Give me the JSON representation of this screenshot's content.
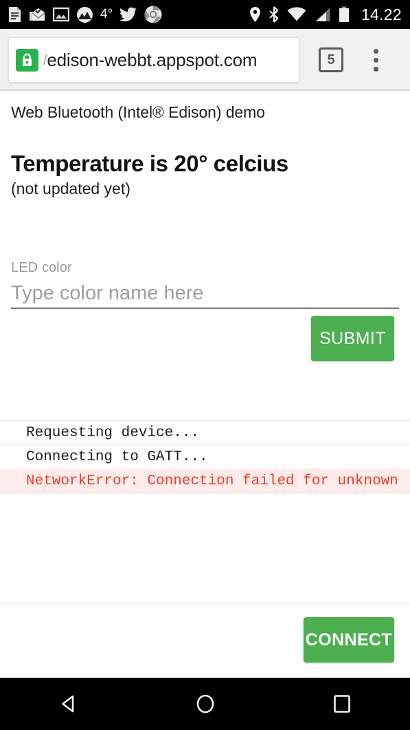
{
  "statusbar": {
    "icons_left": [
      {
        "name": "news-icon"
      },
      {
        "name": "mail-read-icon"
      },
      {
        "name": "photo-icon"
      },
      {
        "name": "weather-icon"
      }
    ],
    "temperature": "4°",
    "icons_left_after": [
      {
        "name": "twitter-icon"
      },
      {
        "name": "chrome-icon"
      }
    ],
    "icons_right": [
      {
        "name": "location-icon"
      },
      {
        "name": "bluetooth-icon"
      },
      {
        "name": "wifi-icon"
      },
      {
        "name": "cellular-signal-icon"
      },
      {
        "name": "battery-icon"
      }
    ],
    "clock": "14.22"
  },
  "browser": {
    "security_icon": "lock-icon",
    "url_prefix": "/",
    "url": "edison-webbt.appspot.com",
    "tab_count": "5",
    "menu_icon": "overflow-menu-icon"
  },
  "page": {
    "subtitle": "Web Bluetooth (Intel® Edison) demo",
    "temperature_heading": "Temperature is 20° celcius",
    "temperature_note": "(not updated yet)",
    "led_field": {
      "label": "LED color",
      "placeholder": "Type color name here",
      "value": ""
    },
    "submit_label": "SUBMIT",
    "connect_label": "CONNECT",
    "log": [
      {
        "text": "Requesting device...",
        "level": "info"
      },
      {
        "text": "Connecting to GATT...",
        "level": "info"
      },
      {
        "text": "NetworkError: Connection failed for unknown",
        "level": "error"
      }
    ]
  },
  "navbar": {
    "back": "back-button",
    "home": "home-button",
    "recents": "recents-button"
  },
  "colors": {
    "accent_green": "#4caf50",
    "lock_green": "#2bb24c",
    "error_text": "#f03a2e",
    "error_bg": "#fdecea",
    "toolbar_bg": "#f1f1f1"
  }
}
